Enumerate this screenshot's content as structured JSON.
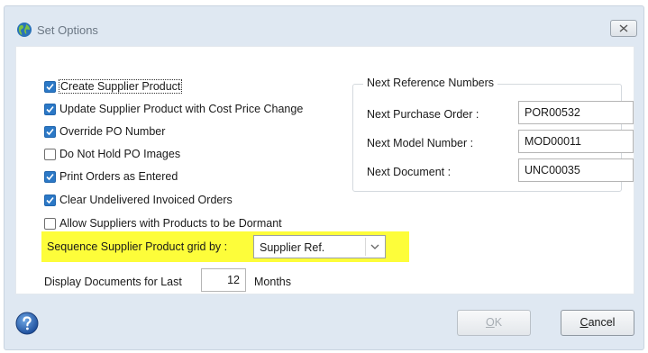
{
  "window": {
    "title": "Set Options",
    "icon": "globe-icon",
    "close_icon": "close-icon"
  },
  "options": [
    {
      "label": "Create Supplier Product",
      "checked": true
    },
    {
      "label": "Update Supplier Product with Cost Price Change",
      "checked": true
    },
    {
      "label": "Override PO Number",
      "checked": true
    },
    {
      "label": "Do Not Hold PO Images",
      "checked": false
    },
    {
      "label": "Print Orders as Entered",
      "checked": true
    },
    {
      "label": "Clear Undelivered Invoiced Orders",
      "checked": true
    },
    {
      "label": "Allow Suppliers with Products to be Dormant",
      "checked": false
    }
  ],
  "next_refs": {
    "title": "Next Reference Numbers",
    "purchase_order": {
      "label": "Next Purchase Order :",
      "value": "POR00532"
    },
    "model_number": {
      "label": "Next Model Number :",
      "value": "MOD00011"
    },
    "document": {
      "label": "Next Document :",
      "value": "UNC00035"
    }
  },
  "sequence": {
    "label": "Sequence Supplier Product grid by :",
    "selected": "Supplier Ref.",
    "highlight_color": "#fdfd3a"
  },
  "display_docs": {
    "label": "Display Documents for Last",
    "value": "12",
    "unit": "Months"
  },
  "buttons": {
    "ok": {
      "mnemonic": "O",
      "rest": "K",
      "enabled": false
    },
    "cancel": {
      "mnemonic": "C",
      "rest": "ancel",
      "enabled": true
    },
    "help_icon": "help-icon"
  },
  "colors": {
    "accent": "#2b78c6",
    "frame": "#dfe8f2"
  }
}
